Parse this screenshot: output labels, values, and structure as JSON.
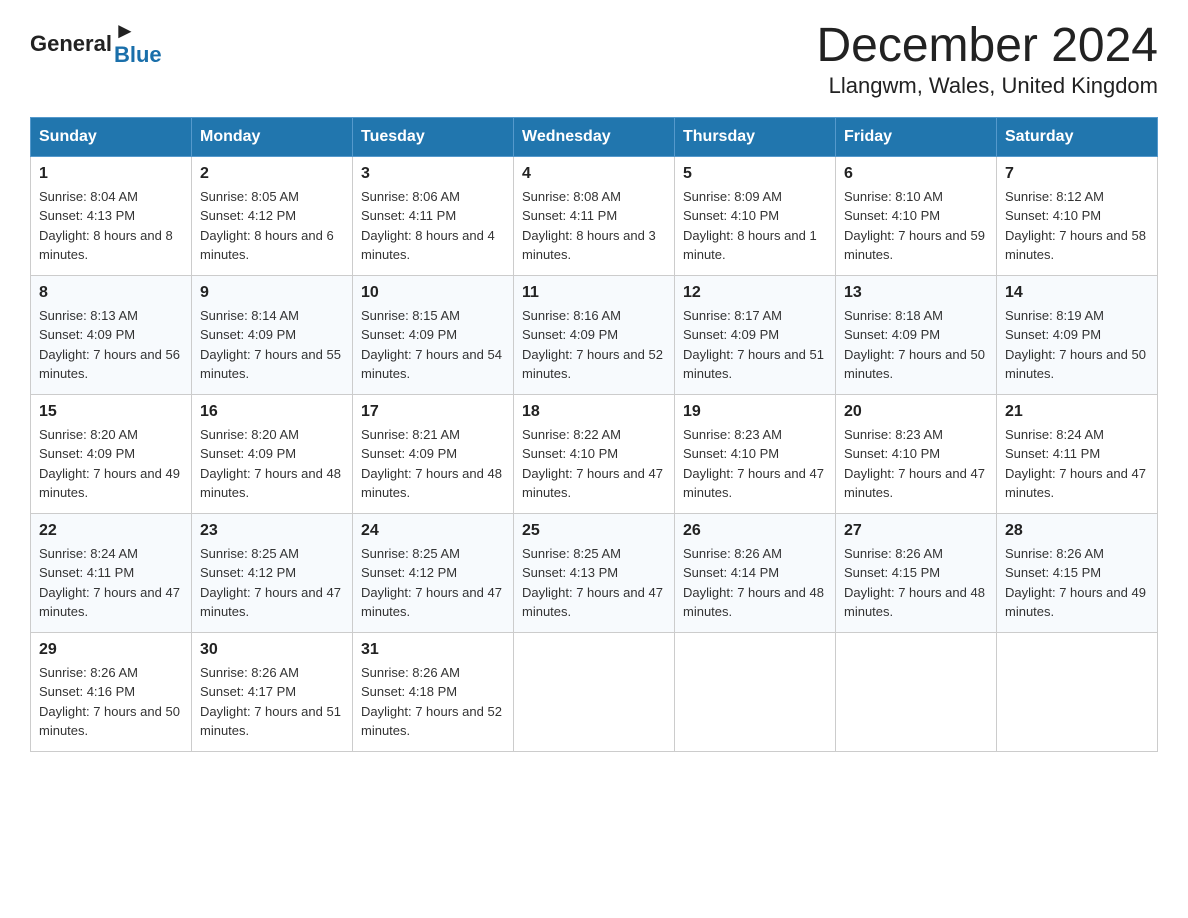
{
  "header": {
    "title": "December 2024",
    "subtitle": "Llangwm, Wales, United Kingdom",
    "logo_general": "General",
    "logo_blue": "Blue"
  },
  "calendar": {
    "days_of_week": [
      "Sunday",
      "Monday",
      "Tuesday",
      "Wednesday",
      "Thursday",
      "Friday",
      "Saturday"
    ],
    "weeks": [
      [
        {
          "day": "1",
          "sunrise": "8:04 AM",
          "sunset": "4:13 PM",
          "daylight": "8 hours and 8 minutes."
        },
        {
          "day": "2",
          "sunrise": "8:05 AM",
          "sunset": "4:12 PM",
          "daylight": "8 hours and 6 minutes."
        },
        {
          "day": "3",
          "sunrise": "8:06 AM",
          "sunset": "4:11 PM",
          "daylight": "8 hours and 4 minutes."
        },
        {
          "day": "4",
          "sunrise": "8:08 AM",
          "sunset": "4:11 PM",
          "daylight": "8 hours and 3 minutes."
        },
        {
          "day": "5",
          "sunrise": "8:09 AM",
          "sunset": "4:10 PM",
          "daylight": "8 hours and 1 minute."
        },
        {
          "day": "6",
          "sunrise": "8:10 AM",
          "sunset": "4:10 PM",
          "daylight": "7 hours and 59 minutes."
        },
        {
          "day": "7",
          "sunrise": "8:12 AM",
          "sunset": "4:10 PM",
          "daylight": "7 hours and 58 minutes."
        }
      ],
      [
        {
          "day": "8",
          "sunrise": "8:13 AM",
          "sunset": "4:09 PM",
          "daylight": "7 hours and 56 minutes."
        },
        {
          "day": "9",
          "sunrise": "8:14 AM",
          "sunset": "4:09 PM",
          "daylight": "7 hours and 55 minutes."
        },
        {
          "day": "10",
          "sunrise": "8:15 AM",
          "sunset": "4:09 PM",
          "daylight": "7 hours and 54 minutes."
        },
        {
          "day": "11",
          "sunrise": "8:16 AM",
          "sunset": "4:09 PM",
          "daylight": "7 hours and 52 minutes."
        },
        {
          "day": "12",
          "sunrise": "8:17 AM",
          "sunset": "4:09 PM",
          "daylight": "7 hours and 51 minutes."
        },
        {
          "day": "13",
          "sunrise": "8:18 AM",
          "sunset": "4:09 PM",
          "daylight": "7 hours and 50 minutes."
        },
        {
          "day": "14",
          "sunrise": "8:19 AM",
          "sunset": "4:09 PM",
          "daylight": "7 hours and 50 minutes."
        }
      ],
      [
        {
          "day": "15",
          "sunrise": "8:20 AM",
          "sunset": "4:09 PM",
          "daylight": "7 hours and 49 minutes."
        },
        {
          "day": "16",
          "sunrise": "8:20 AM",
          "sunset": "4:09 PM",
          "daylight": "7 hours and 48 minutes."
        },
        {
          "day": "17",
          "sunrise": "8:21 AM",
          "sunset": "4:09 PM",
          "daylight": "7 hours and 48 minutes."
        },
        {
          "day": "18",
          "sunrise": "8:22 AM",
          "sunset": "4:10 PM",
          "daylight": "7 hours and 47 minutes."
        },
        {
          "day": "19",
          "sunrise": "8:23 AM",
          "sunset": "4:10 PM",
          "daylight": "7 hours and 47 minutes."
        },
        {
          "day": "20",
          "sunrise": "8:23 AM",
          "sunset": "4:10 PM",
          "daylight": "7 hours and 47 minutes."
        },
        {
          "day": "21",
          "sunrise": "8:24 AM",
          "sunset": "4:11 PM",
          "daylight": "7 hours and 47 minutes."
        }
      ],
      [
        {
          "day": "22",
          "sunrise": "8:24 AM",
          "sunset": "4:11 PM",
          "daylight": "7 hours and 47 minutes."
        },
        {
          "day": "23",
          "sunrise": "8:25 AM",
          "sunset": "4:12 PM",
          "daylight": "7 hours and 47 minutes."
        },
        {
          "day": "24",
          "sunrise": "8:25 AM",
          "sunset": "4:12 PM",
          "daylight": "7 hours and 47 minutes."
        },
        {
          "day": "25",
          "sunrise": "8:25 AM",
          "sunset": "4:13 PM",
          "daylight": "7 hours and 47 minutes."
        },
        {
          "day": "26",
          "sunrise": "8:26 AM",
          "sunset": "4:14 PM",
          "daylight": "7 hours and 48 minutes."
        },
        {
          "day": "27",
          "sunrise": "8:26 AM",
          "sunset": "4:15 PM",
          "daylight": "7 hours and 48 minutes."
        },
        {
          "day": "28",
          "sunrise": "8:26 AM",
          "sunset": "4:15 PM",
          "daylight": "7 hours and 49 minutes."
        }
      ],
      [
        {
          "day": "29",
          "sunrise": "8:26 AM",
          "sunset": "4:16 PM",
          "daylight": "7 hours and 50 minutes."
        },
        {
          "day": "30",
          "sunrise": "8:26 AM",
          "sunset": "4:17 PM",
          "daylight": "7 hours and 51 minutes."
        },
        {
          "day": "31",
          "sunrise": "8:26 AM",
          "sunset": "4:18 PM",
          "daylight": "7 hours and 52 minutes."
        },
        null,
        null,
        null,
        null
      ]
    ]
  }
}
